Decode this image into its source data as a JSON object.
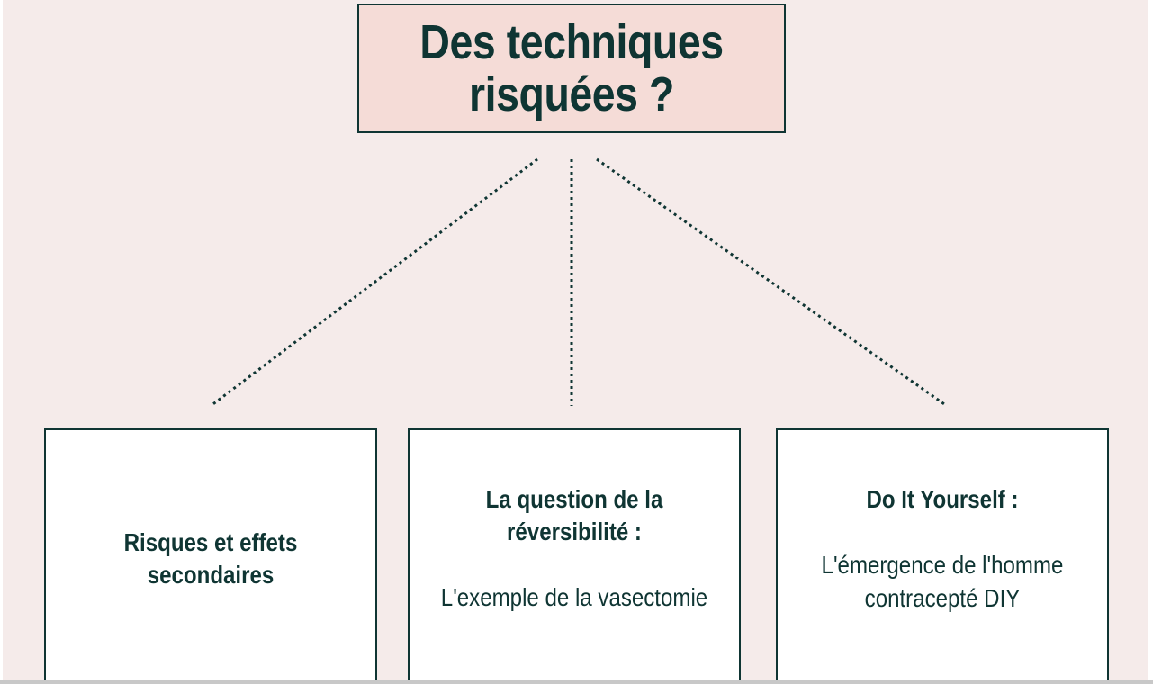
{
  "diagram": {
    "title": "Des techniques risquées ?",
    "boxes": [
      {
        "title": "Risques et effets secondaires",
        "body": ""
      },
      {
        "title": "La question de la réversibilité :",
        "body": "L'exemple de la vasectomie"
      },
      {
        "title": "Do It Yourself :",
        "body": "L'émergence de l'homme contracepté DIY"
      }
    ]
  },
  "colors": {
    "background": "#f5ebea",
    "title_fill": "#f5dcd7",
    "ink": "#0f3533",
    "box_fill": "#ffffff"
  }
}
